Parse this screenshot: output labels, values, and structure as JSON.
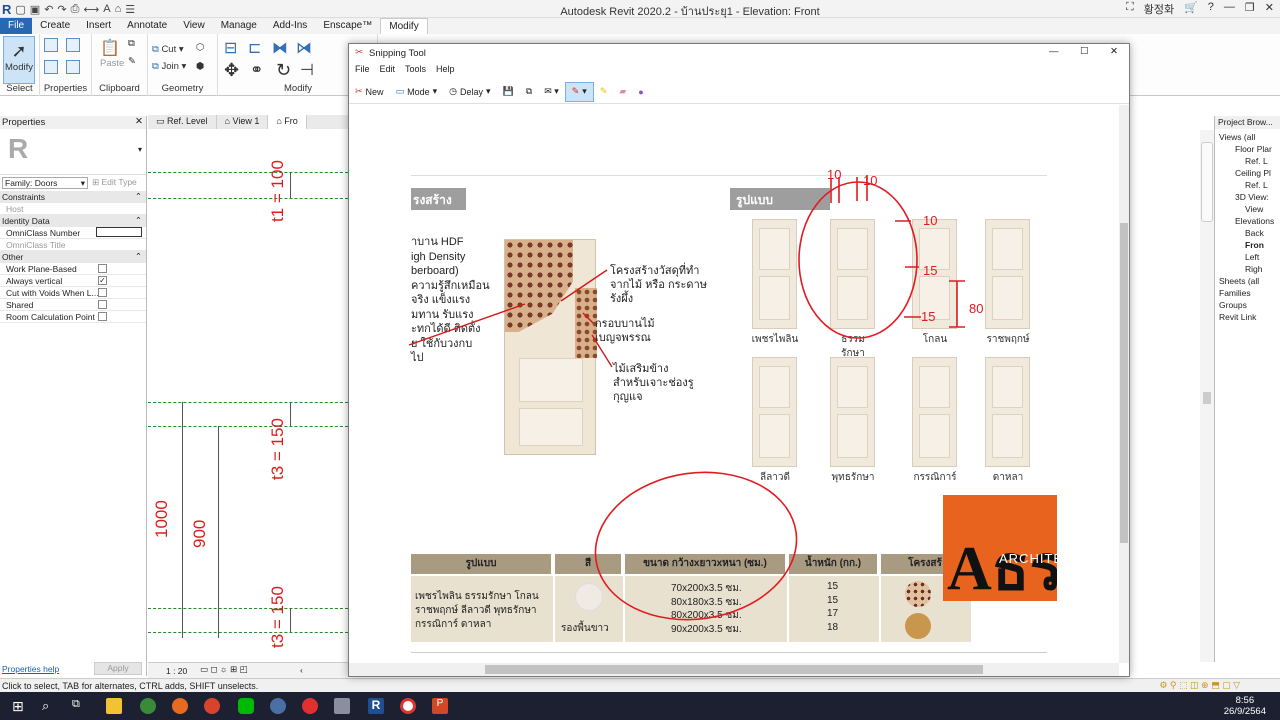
{
  "app": {
    "title": "Autodesk Revit 2020.2 - บ้านประยุ1 - Elevation: Front",
    "user": "황정화"
  },
  "menu": [
    "File",
    "Create",
    "Insert",
    "Annotate",
    "View",
    "Manage",
    "Add-Ins",
    "Enscape™",
    "Modify"
  ],
  "ribbon": {
    "modify": "Modify",
    "select": "Select",
    "properties": "Properties",
    "clipboard": "Clipboard",
    "paste": "Paste",
    "cut": "Cut",
    "join": "Join",
    "geometry": "Geometry",
    "modify_group": "Modify"
  },
  "properties": {
    "title": "Properties",
    "family": "Family: Doors",
    "edit_type": "Edit Type",
    "rows": [
      {
        "label": "Constraints",
        "section": true
      },
      {
        "label": "Host",
        "section": false
      },
      {
        "label": "Identity Data",
        "section": true
      },
      {
        "label": "OmniClass Number",
        "section": false
      },
      {
        "label": "OmniClass Title",
        "section": false
      },
      {
        "label": "Other",
        "section": true
      },
      {
        "label": "Work Plane-Based",
        "section": false
      },
      {
        "label": "Always vertical",
        "section": false
      },
      {
        "label": "Cut with Voids When L...",
        "section": false
      },
      {
        "label": "Shared",
        "section": false
      },
      {
        "label": "Room Calculation Point",
        "section": false
      }
    ],
    "help": "Properties help",
    "apply": "Apply"
  },
  "view_tabs": [
    "Ref. Level",
    "View 1",
    "Fro"
  ],
  "canvas": {
    "dims": [
      "t1 = 100",
      "t3 = 150",
      "1000",
      "900",
      "t3 = 150"
    ],
    "scale": "1 : 20"
  },
  "project_browser": {
    "title": "Project Brow...",
    "items": [
      "Views (all",
      "Floor Plar",
      "Ref. L",
      "Ceiling Pl",
      "Ref. L",
      "3D View:",
      "View",
      "Elevations",
      "Back",
      "Fron",
      "Left",
      "Righ",
      "Sheets (all",
      "Families",
      "Groups",
      "Revit Link"
    ]
  },
  "status_bar": "Click to select, TAB for alternates, CTRL adds, SHIFT unselects.",
  "clock": {
    "time": "8:56",
    "date": "26/9/2564"
  },
  "snip": {
    "title": "Snipping Tool",
    "menu": [
      "File",
      "Edit",
      "Tools",
      "Help"
    ],
    "new": "New",
    "mode": "Mode",
    "delay": "Delay"
  },
  "catalog": {
    "left_header": "รงสร้าง",
    "right_header": "รูปแบบ",
    "left_desc": [
      "าบาน HDF",
      "igh Density",
      "berboard)",
      "ความรู้สึกเหมือน",
      "จริง แข็งแรง",
      "มทาน รับแรง",
      "ะทกได้ดี ติดตั้ง",
      "ย ใช้กับวงกบ",
      "ไป"
    ],
    "callouts": [
      "โครงสร้างวัสดุที่ทำ",
      "จากไม้ หรือ กระดาษ",
      "รังผึ้ง",
      "กรอบบานไม้",
      "เบญจพรรณ",
      "ไม้เสริมข้าง",
      "สำหรับเจาะช่องรู",
      "กุญแจ"
    ],
    "styles_row1": [
      "เพชรไพลิน",
      "ธรรม",
      "รักษา",
      "โกลน",
      "ราชพฤกษ์"
    ],
    "styles_row2": [
      "ลีลาวดี",
      "พุทธรักษา",
      "กรรณิการ์",
      "ดาหลา"
    ],
    "table_headers": [
      "รูปแบบ",
      "สี",
      "ขนาด กว้างxยาวxหนา (ซม.)",
      "น้ำหนัก (กก.)",
      "โครงสร้"
    ],
    "table_models": [
      "เพชรไพลิน ธรรมรักษา โกลน",
      "ราชพฤกษ์ ลีลาวดี พุทธรักษา",
      "กรรณิการ์ ดาหลา"
    ],
    "table_color": "รองพื้นขาว",
    "table_sizes": [
      "70x200x3.5 ซม.",
      "80x180x3.5 ซม.",
      "80x200x3.5 ซม.",
      "90x200x3.5 ซม."
    ],
    "table_weights": [
      "15",
      "15",
      "17",
      "18"
    ],
    "logo_text": "ARCHITE",
    "logo_letters": "Aธร",
    "annotations": [
      "10",
      "10",
      "15",
      "15",
      "10",
      "80"
    ]
  }
}
